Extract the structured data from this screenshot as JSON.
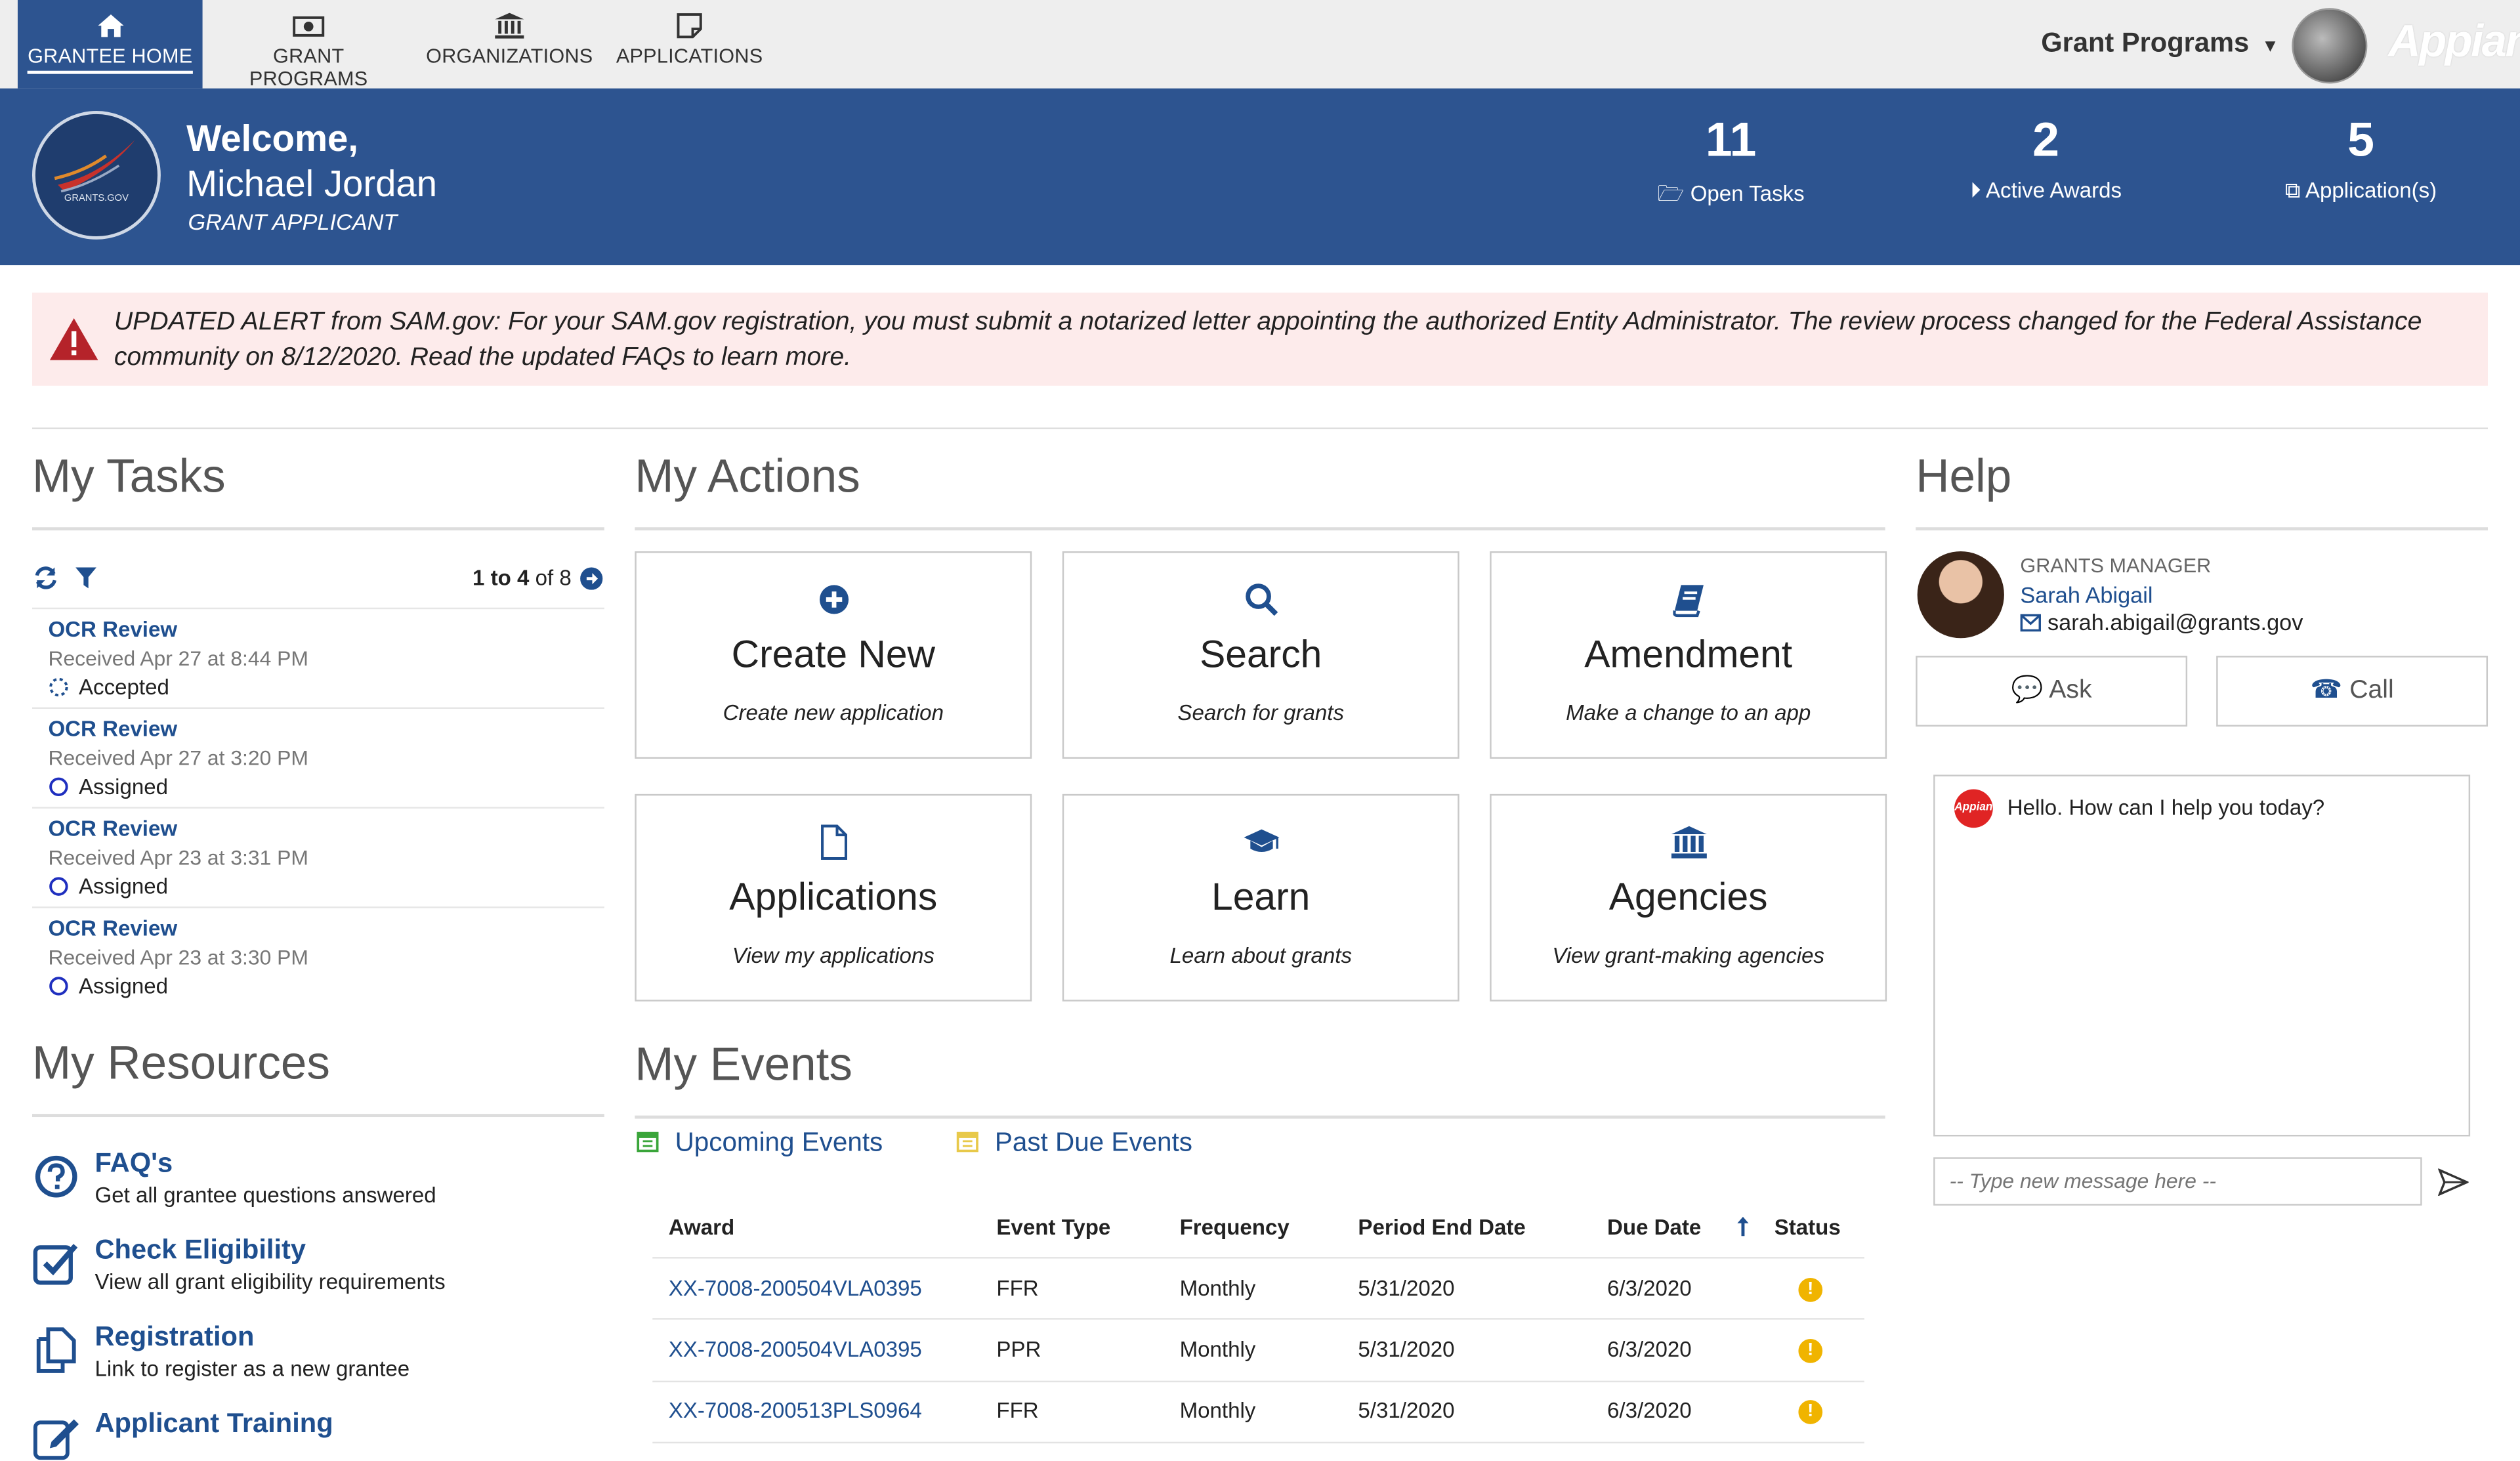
{
  "nav": {
    "tabs": [
      {
        "label": "GRANTEE HOME",
        "icon": "home-icon"
      },
      {
        "label": "GRANT PROGRAMS",
        "icon": "money-icon"
      },
      {
        "label": "ORGANIZATIONS",
        "icon": "bank-icon"
      },
      {
        "label": "APPLICATIONS",
        "icon": "note-icon"
      }
    ],
    "app_menu": "Grant Programs",
    "brand": "Appian"
  },
  "banner": {
    "logo_text": "GRANTS.GOV",
    "welcome": "Welcome,",
    "user_name": "Michael Jordan",
    "user_role": "GRANT APPLICANT",
    "stats": [
      {
        "value": "11",
        "label": "Open Tasks",
        "icon": "folder-open-icon"
      },
      {
        "value": "2",
        "label": "Active Awards",
        "icon": "play-circle-icon"
      },
      {
        "value": "5",
        "label": "Application(s)",
        "icon": "copy-icon"
      }
    ]
  },
  "alert": {
    "text": "UPDATED ALERT from SAM.gov: For your SAM.gov registration, you must submit a notarized letter appointing the authorized Entity Administrator. The review process changed for the Federal Assistance community on 8/12/2020. Read the updated FAQs to learn more."
  },
  "tasks": {
    "heading": "My Tasks",
    "pagination": {
      "range": "1 to 4",
      "of": "of 8"
    },
    "items": [
      {
        "title": "OCR Review",
        "received": "Received Apr 27 at 8:44 PM",
        "status": "Accepted"
      },
      {
        "title": "OCR Review",
        "received": "Received Apr 27 at 3:20 PM",
        "status": "Assigned"
      },
      {
        "title": "OCR Review",
        "received": "Received Apr 23 at 3:31 PM",
        "status": "Assigned"
      },
      {
        "title": "OCR Review",
        "received": "Received Apr 23 at 3:30 PM",
        "status": "Assigned"
      }
    ]
  },
  "resources": {
    "heading": "My Resources",
    "items": [
      {
        "title": "FAQ's",
        "desc": "Get all grantee questions answered",
        "icon": "question-circle-icon"
      },
      {
        "title": "Check Eligibility",
        "desc": "View all grant eligibility requirements",
        "icon": "checkbox-icon"
      },
      {
        "title": "Registration",
        "desc": "Link to register as a new grantee",
        "icon": "copy-icon"
      },
      {
        "title": "Applicant Training",
        "desc": "",
        "icon": "edit-icon"
      }
    ]
  },
  "actions": {
    "heading": "My Actions",
    "cards": [
      {
        "title": "Create New",
        "subtitle": "Create new application",
        "icon": "plus-circle-icon"
      },
      {
        "title": "Search",
        "subtitle": "Search for grants",
        "icon": "search-icon"
      },
      {
        "title": "Amendment",
        "subtitle": "Make a change to an app",
        "icon": "book-icon"
      },
      {
        "title": "Applications",
        "subtitle": "View my applications",
        "icon": "file-icon"
      },
      {
        "title": "Learn",
        "subtitle": "Learn about grants",
        "icon": "graduation-cap-icon"
      },
      {
        "title": "Agencies",
        "subtitle": "View grant-making agencies",
        "icon": "bank-icon"
      }
    ]
  },
  "events": {
    "heading": "My Events",
    "tabs": [
      "Upcoming Events",
      "Past Due Events"
    ],
    "columns": [
      "Award",
      "Event Type",
      "Frequency",
      "Period End Date",
      "Due Date",
      "Status"
    ],
    "rows": [
      {
        "award": "XX-7008-200504VLA0395",
        "type": "FFR",
        "frequency": "Monthly",
        "period_end": "5/31/2020",
        "due": "6/3/2020",
        "status": "warning"
      },
      {
        "award": "XX-7008-200504VLA0395",
        "type": "PPR",
        "frequency": "Monthly",
        "period_end": "5/31/2020",
        "due": "6/3/2020",
        "status": "warning"
      },
      {
        "award": "XX-7008-200513PLS0964",
        "type": "FFR",
        "frequency": "Monthly",
        "period_end": "5/31/2020",
        "due": "6/3/2020",
        "status": "warning"
      }
    ]
  },
  "help": {
    "heading": "Help",
    "manager_role": "GRANTS MANAGER",
    "manager_name": "Sarah Abigail",
    "manager_email": "sarah.abigail@grants.gov",
    "ask_label": "Ask",
    "call_label": "Call",
    "chat_message": "Hello. How can I help you today?",
    "chat_badge": "Appian",
    "chat_placeholder": "-- Type new message here --"
  }
}
